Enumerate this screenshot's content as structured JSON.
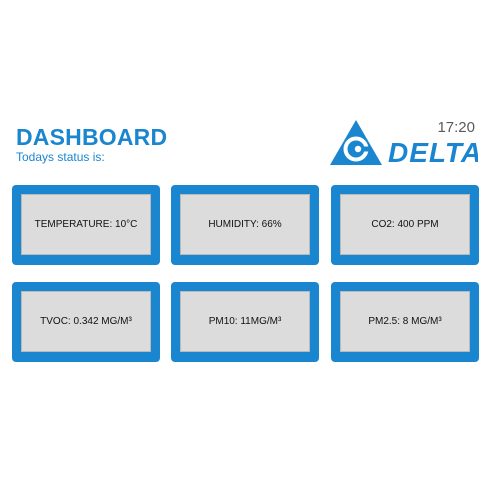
{
  "header": {
    "title": "DASHBOARD",
    "subtitle": "Todays status is:",
    "time": "17:20",
    "logo_text": "DELTA",
    "logo_icon": "delta-triangle-logo"
  },
  "colors": {
    "brand_blue": "#1a86cf",
    "panel_gray": "#dcdcdc",
    "text_dark": "#111111",
    "clock_gray": "#5a5a5a"
  },
  "cards": [
    {
      "label": "TEMPERATURE: 10°C"
    },
    {
      "label": "HUMIDITY: 66%"
    },
    {
      "label": "CO2: 400 PPM"
    },
    {
      "label": "TVOC: 0.342 MG/M³"
    },
    {
      "label": "PM10: 11MG/M³"
    },
    {
      "label": "PM2.5: 8 MG/M³"
    }
  ]
}
